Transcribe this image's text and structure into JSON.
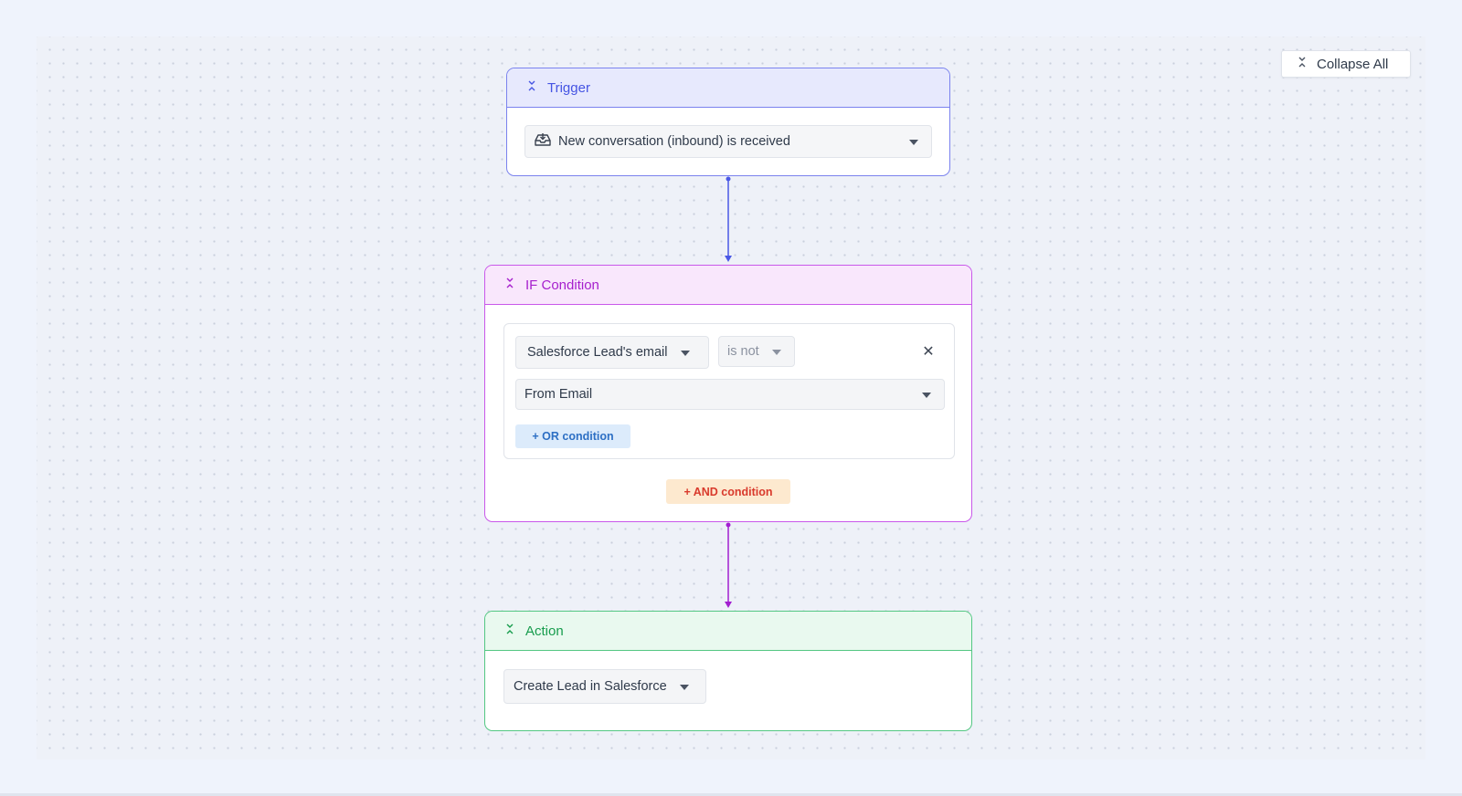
{
  "toolbar": {
    "collapse_all_label": "Collapse All"
  },
  "trigger": {
    "title": "Trigger",
    "event_value": "New conversation (inbound) is received",
    "event_icon": "inbox-icon"
  },
  "if_condition": {
    "title": "IF Condition",
    "field_value": "Salesforce Lead's email",
    "operator_value": "is not",
    "compare_value": "From Email",
    "or_button_label": "+ OR condition",
    "and_button_label": "+ AND condition",
    "remove_icon": "close-icon"
  },
  "action": {
    "title": "Action",
    "action_value": "Create Lead in Salesforce"
  },
  "colors": {
    "trigger_accent": "#4554e3",
    "condition_accent": "#a61fcd",
    "action_accent": "#179c4d",
    "and_button_text": "#d93a2c",
    "or_button_text": "#2d6fc4"
  }
}
